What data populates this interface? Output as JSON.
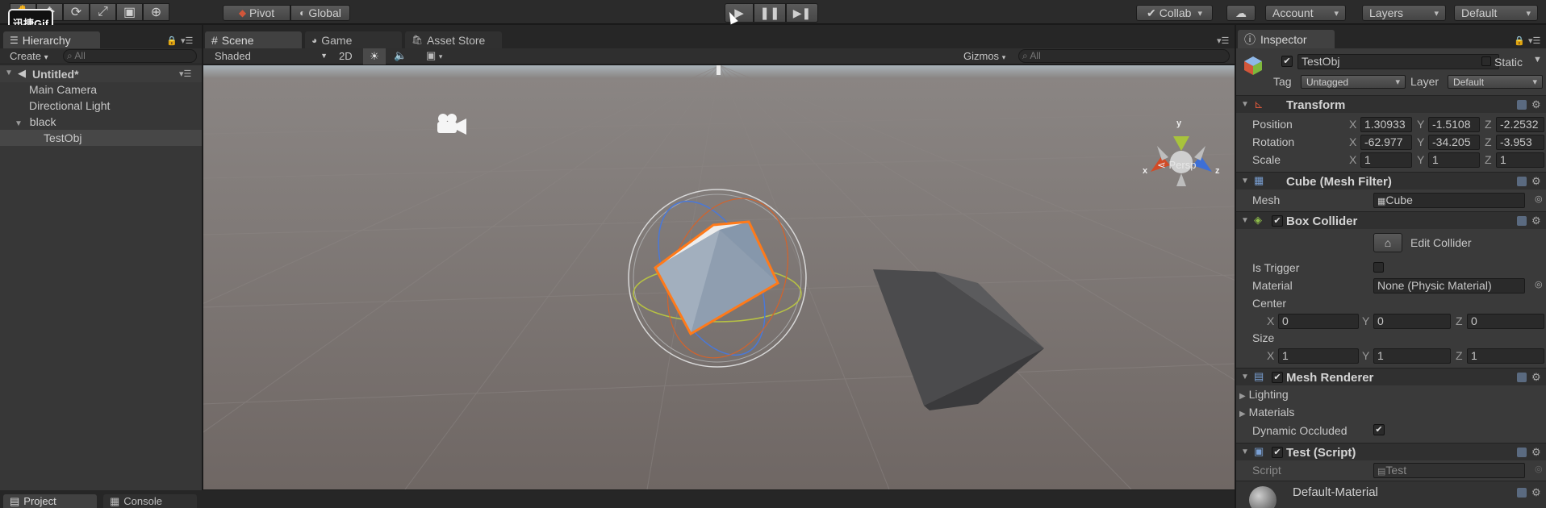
{
  "watermark": "迅捷Gif",
  "toolbar": {
    "pivot": "Pivot",
    "global": "Global",
    "collab": "Collab",
    "account": "Account",
    "layers": "Layers",
    "layout": "Default"
  },
  "hierarchy": {
    "tab": "Hierarchy",
    "create": "Create",
    "search_placeholder": "All",
    "scene": "Untitled*",
    "items": [
      "Main Camera",
      "Directional Light",
      "black",
      "TestObj"
    ]
  },
  "scene_view": {
    "tabs": [
      "Scene",
      "Game",
      "Asset Store"
    ],
    "shading": "Shaded",
    "mode_2d": "2D",
    "gizmos": "Gizmos",
    "search_placeholder": "All",
    "persp": "Persp",
    "axis_x": "x",
    "axis_y": "y",
    "axis_z": "z"
  },
  "bottom_tabs": [
    "Project",
    "Console"
  ],
  "inspector": {
    "tab": "Inspector",
    "object_name": "TestObj",
    "static": "Static",
    "tag_label": "Tag",
    "tag_value": "Untagged",
    "layer_label": "Layer",
    "layer_value": "Default",
    "transform": {
      "title": "Transform",
      "position_label": "Position",
      "rotation_label": "Rotation",
      "scale_label": "Scale",
      "position": {
        "x": "1.30933",
        "y": "-1.5108",
        "z": "-2.2532"
      },
      "rotation": {
        "x": "-62.977",
        "y": "-34.205",
        "z": "-3.953"
      },
      "scale": {
        "x": "1",
        "y": "1",
        "z": "1"
      }
    },
    "mesh_filter": {
      "title": "Cube (Mesh Filter)",
      "mesh_label": "Mesh",
      "mesh_value": "Cube"
    },
    "box_collider": {
      "title": "Box Collider",
      "edit_collider": "Edit Collider",
      "is_trigger_label": "Is Trigger",
      "material_label": "Material",
      "material_value": "None (Physic Material)",
      "center_label": "Center",
      "center": {
        "x": "0",
        "y": "0",
        "z": "0"
      },
      "size_label": "Size",
      "size": {
        "x": "1",
        "y": "1",
        "z": "1"
      }
    },
    "mesh_renderer": {
      "title": "Mesh Renderer",
      "lighting": "Lighting",
      "materials": "Materials",
      "dynamic_occluded": "Dynamic Occluded"
    },
    "test_script": {
      "title": "Test (Script)",
      "script_label": "Script",
      "script_value": "Test"
    },
    "material": "Default-Material"
  },
  "colors": {
    "scene_bg": "#787170",
    "selection_outline": "#ff7a1a",
    "axis_x": "#d24b27",
    "axis_y": "#a8c33c",
    "axis_z": "#3d6fd6"
  },
  "axis_letters": [
    "X",
    "Y",
    "Z"
  ]
}
